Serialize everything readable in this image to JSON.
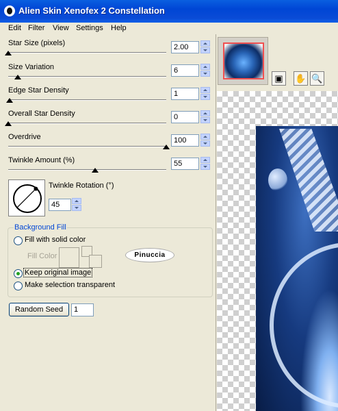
{
  "window": {
    "title": "Alien Skin Xenofex 2 Constellation"
  },
  "menu": [
    "Edit",
    "Filter",
    "View",
    "Settings",
    "Help"
  ],
  "params": [
    {
      "label": "Star Size (pixels)",
      "value": "2.00",
      "level": 0.0
    },
    {
      "label": "Size Variation",
      "value": "6",
      "level": 0.06
    },
    {
      "label": "Edge Star Density",
      "value": "1",
      "level": 0.01
    },
    {
      "label": "Overall Star Density",
      "value": "0",
      "level": 0.0
    },
    {
      "label": "Overdrive",
      "value": "100",
      "level": 1.0
    },
    {
      "label": "Twinkle Amount (%)",
      "value": "55",
      "level": 0.55
    }
  ],
  "rotation": {
    "label": "Twinkle Rotation (°)",
    "value": "45"
  },
  "background_fill": {
    "title": "Background Fill",
    "options": [
      "Fill with solid color",
      "Keep original image",
      "Make selection transparent"
    ],
    "selected": 1,
    "fill_color_label": "Fill Color"
  },
  "watermark": "Pinuccia",
  "random_seed": {
    "label": "Random Seed",
    "value": "1"
  },
  "tools": [
    "preview-navigator-icon",
    "hand-icon",
    "zoom-icon"
  ]
}
